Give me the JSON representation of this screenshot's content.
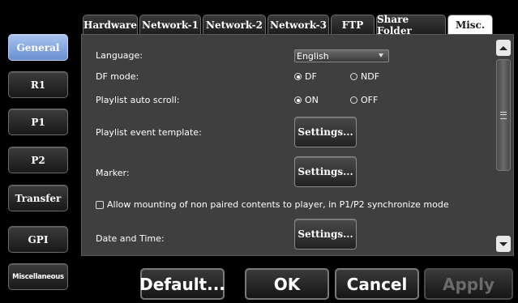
{
  "sidebar": {
    "items": [
      {
        "label": "General",
        "active": true
      },
      {
        "label": "R1"
      },
      {
        "label": "P1"
      },
      {
        "label": "P2"
      },
      {
        "label": "Transfer"
      },
      {
        "label": "GPI"
      },
      {
        "label": "Miscellaneous"
      }
    ]
  },
  "tabs": [
    {
      "label": "Hardware"
    },
    {
      "label": "Network-1"
    },
    {
      "label": "Network-2"
    },
    {
      "label": "Network-3"
    },
    {
      "label": "FTP"
    },
    {
      "label": "Share Folder"
    },
    {
      "label": "Misc.",
      "active": true
    }
  ],
  "settings": {
    "language_label": "Language:",
    "language_value": "English",
    "df_mode_label": "DF mode:",
    "df_option": "DF",
    "ndf_option": "NDF",
    "playlist_scroll_label": "Playlist auto scroll:",
    "on_option": "ON",
    "off_option": "OFF",
    "playlist_template_label": "Playlist event template:",
    "marker_label": "Marker:",
    "allow_mount_label": "Allow mounting of non paired contents to player, in P1/P2 synchronize mode",
    "date_time_label": "Date and Time:",
    "settings_button": "Settings..."
  },
  "footer": {
    "default": "Default...",
    "ok": "OK",
    "cancel": "Cancel",
    "apply": "Apply"
  },
  "colors": {
    "active_side": "#8fb0e8",
    "panel_bg": "#3f3f3f",
    "active_tab": "#ffffff"
  }
}
